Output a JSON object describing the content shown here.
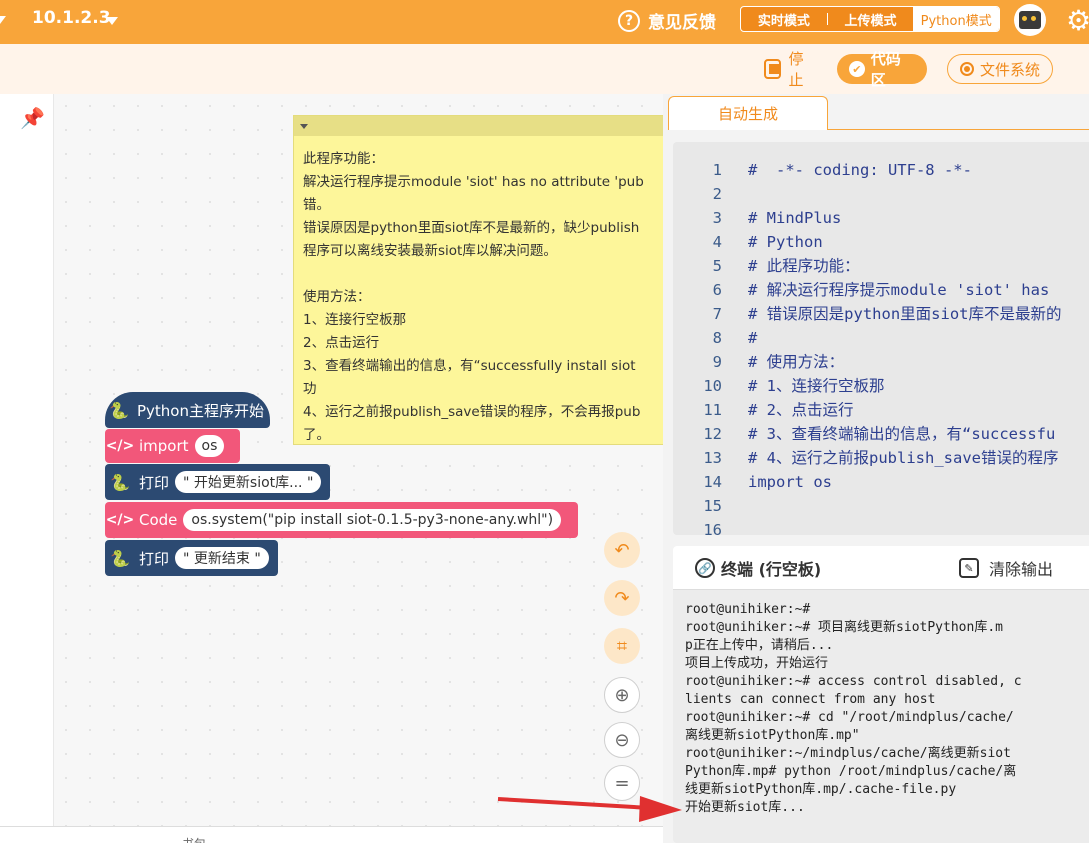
{
  "topbar": {
    "version": "10.1.2.3",
    "feedback_label": "意见反馈",
    "modes": [
      "实时模式",
      "上传模式",
      "Python模式"
    ],
    "active_mode_index": 2
  },
  "toolbar": {
    "stop_label": "停止",
    "code_area_label": "代码区",
    "file_system_label": "文件系统"
  },
  "comment": {
    "text": "此程序功能：\n解决运行程序提示module 'siot' has no attribute 'pub\n错。\n错误原因是python里面siot库不是最新的，缺少publish\n程序可以离线安装最新siot库以解决问题。\n\n使用方法：\n1、连接行空板那\n2、点击运行\n3、查看终端输出的信息，有“successfully install siot\n功\n4、运行之前报publish_save错误的程序，不会再报pub\n了。"
  },
  "blocks": {
    "main_start": "Python主程序开始",
    "import_label": "import",
    "import_value": "os",
    "print1_label": "打印",
    "print1_value": "\" 开始更新siot库... \"",
    "code_label": "Code",
    "code_value": "os.system(\"pip install siot-0.1.5-py3-none-any.whl\")",
    "print2_label": "打印",
    "print2_value": "\" 更新结束 \""
  },
  "bottom_cut_label": "书包",
  "editor": {
    "tab_label": "自动生成",
    "lines": [
      {
        "n": "1",
        "t": "#  -*- coding: UTF-8 -*-"
      },
      {
        "n": "2",
        "t": ""
      },
      {
        "n": "3",
        "t": "# MindPlus"
      },
      {
        "n": "4",
        "t": "# Python"
      },
      {
        "n": "5",
        "t": "# 此程序功能："
      },
      {
        "n": "6",
        "t": "# 解决运行程序提示module 'siot' has"
      },
      {
        "n": "7",
        "t": "# 错误原因是python里面siot库不是最新的"
      },
      {
        "n": "8",
        "t": "#"
      },
      {
        "n": "9",
        "t": "# 使用方法："
      },
      {
        "n": "10",
        "t": "# 1、连接行空板那"
      },
      {
        "n": "11",
        "t": "# 2、点击运行"
      },
      {
        "n": "12",
        "t": "# 3、查看终端输出的信息，有“successfu"
      },
      {
        "n": "13",
        "t": "# 4、运行之前报publish_save错误的程序"
      },
      {
        "n": "14",
        "t": "import os"
      },
      {
        "n": "15",
        "t": ""
      },
      {
        "n": "16",
        "t": ""
      }
    ]
  },
  "terminal": {
    "title": "终端 (行空板)",
    "clear_label": "清除输出",
    "output": "root@unihiker:~#\nroot@unihiker:~# 项目离线更新siotPython库.m\np正在上传中，请稍后...\n项目上传成功，开始运行\nroot@unihiker:~# access control disabled, c\nlients can connect from any host\nroot@unihiker:~# cd \"/root/mindplus/cache/\n离线更新siotPython库.mp\"\nroot@unihiker:~/mindplus/cache/离线更新siot\nPython库.mp# python /root/mindplus/cache/离\n线更新siotPython库.mp/.cache-file.py\n开始更新siot库..."
  },
  "colors": {
    "brand_orange": "#f8a53a",
    "python_block": "#2c4a72",
    "code_block": "#f2577a",
    "comment_bg": "#fdf69a",
    "arrow": "#e03030"
  }
}
